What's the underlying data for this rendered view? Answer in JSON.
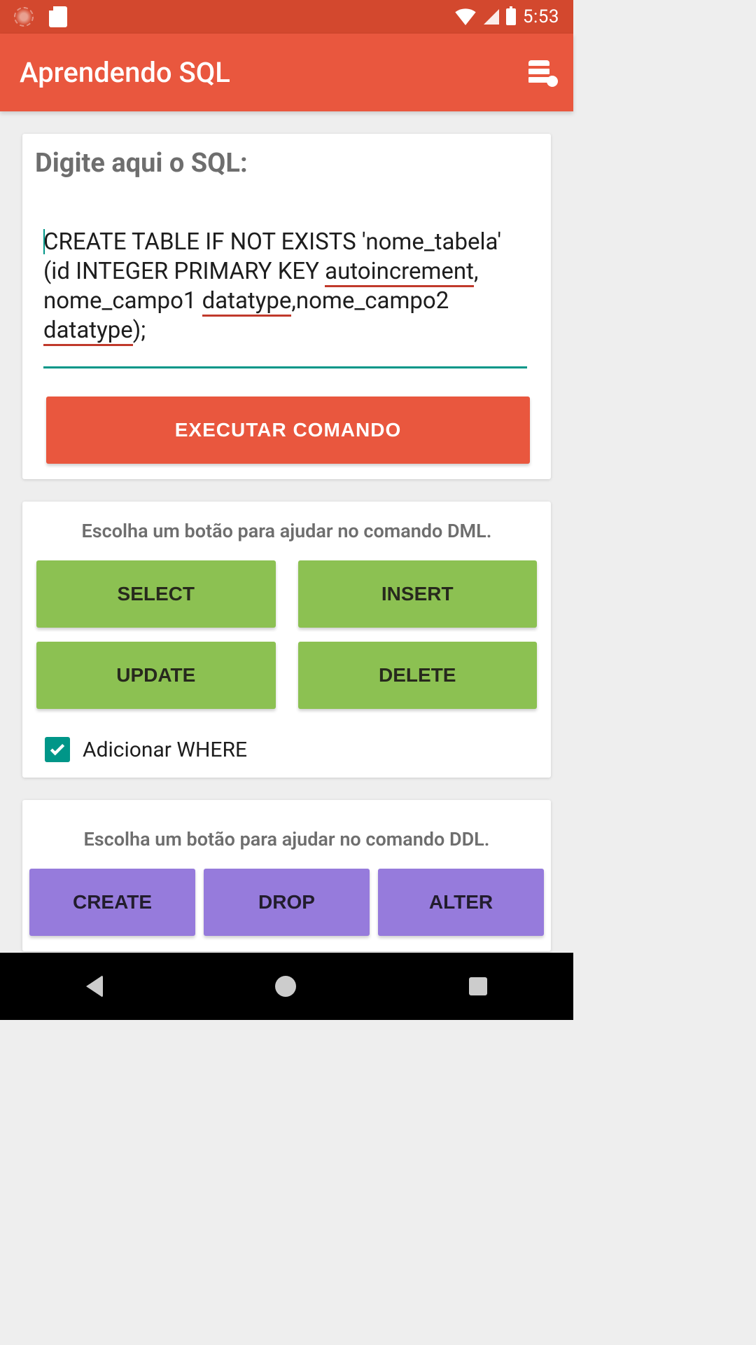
{
  "status": {
    "time": "5:53"
  },
  "app": {
    "title": "Aprendendo SQL"
  },
  "sql_card": {
    "title": "Digite aqui o SQL:",
    "sql_parts": {
      "p1": "CREATE TABLE IF NOT EXISTS 'nome_tabela' (id INTEGER PRIMARY KEY ",
      "u1": "autoincrement",
      "p2": ", nome_campo1 ",
      "u2": "datatype",
      "p3": ",nome_campo2 ",
      "u3": "datatype",
      "p4": ");"
    },
    "execute_label": "EXECUTAR COMANDO"
  },
  "dml": {
    "helper": "Escolha um botão para ajudar no comando DML.",
    "buttons": [
      "SELECT",
      "INSERT",
      "UPDATE",
      "DELETE"
    ],
    "checkbox_label": "Adicionar WHERE",
    "checkbox_checked": true
  },
  "ddl": {
    "helper": "Escolha um botão para ajudar no comando DDL.",
    "buttons": [
      "CREATE",
      "DROP",
      "ALTER"
    ]
  }
}
